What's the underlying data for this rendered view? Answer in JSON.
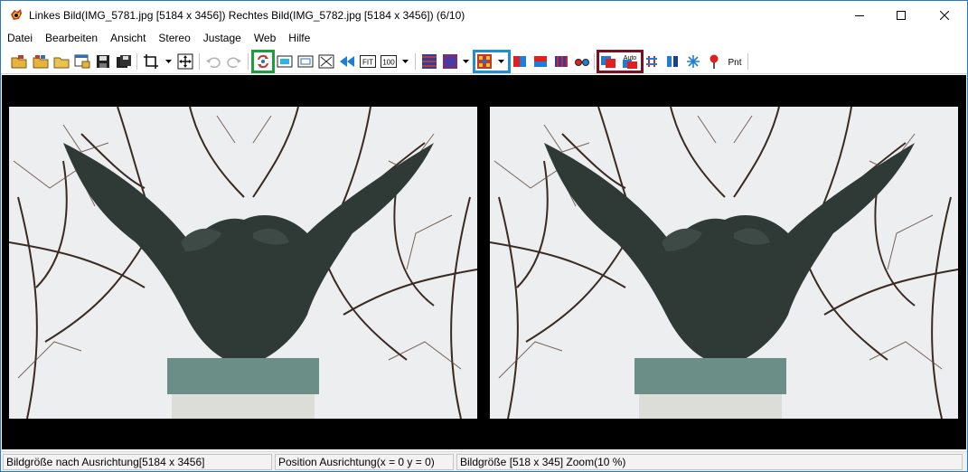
{
  "window": {
    "title": "Linkes Bild(IMG_5781.jpg [5184 x 3456]) Rechtes Bild(IMG_5782.jpg [5184 x 3456])  (6/10)",
    "icon": "app-icon"
  },
  "menu": {
    "items": [
      "Datei",
      "Bearbeiten",
      "Ansicht",
      "Stereo",
      "Justage",
      "Web",
      "Hilfe"
    ]
  },
  "toolbar": {
    "fit_label": "FIT",
    "zoom100_label": "100",
    "auto_label": "Auto",
    "pnt_label": "Pnt",
    "highlight_colors": {
      "swap": "#1a9f3c",
      "anaglyph": "#1e8ed6",
      "autoalign": "#7a1020"
    }
  },
  "status": {
    "align_size": "Bildgröße nach Ausrichtung[5184 x 3456]",
    "align_position": "Position Ausrichtung(x = 0 y = 0)",
    "image_size_zoom": "Bildgröße [518 x 345]  Zoom(10 %)"
  }
}
